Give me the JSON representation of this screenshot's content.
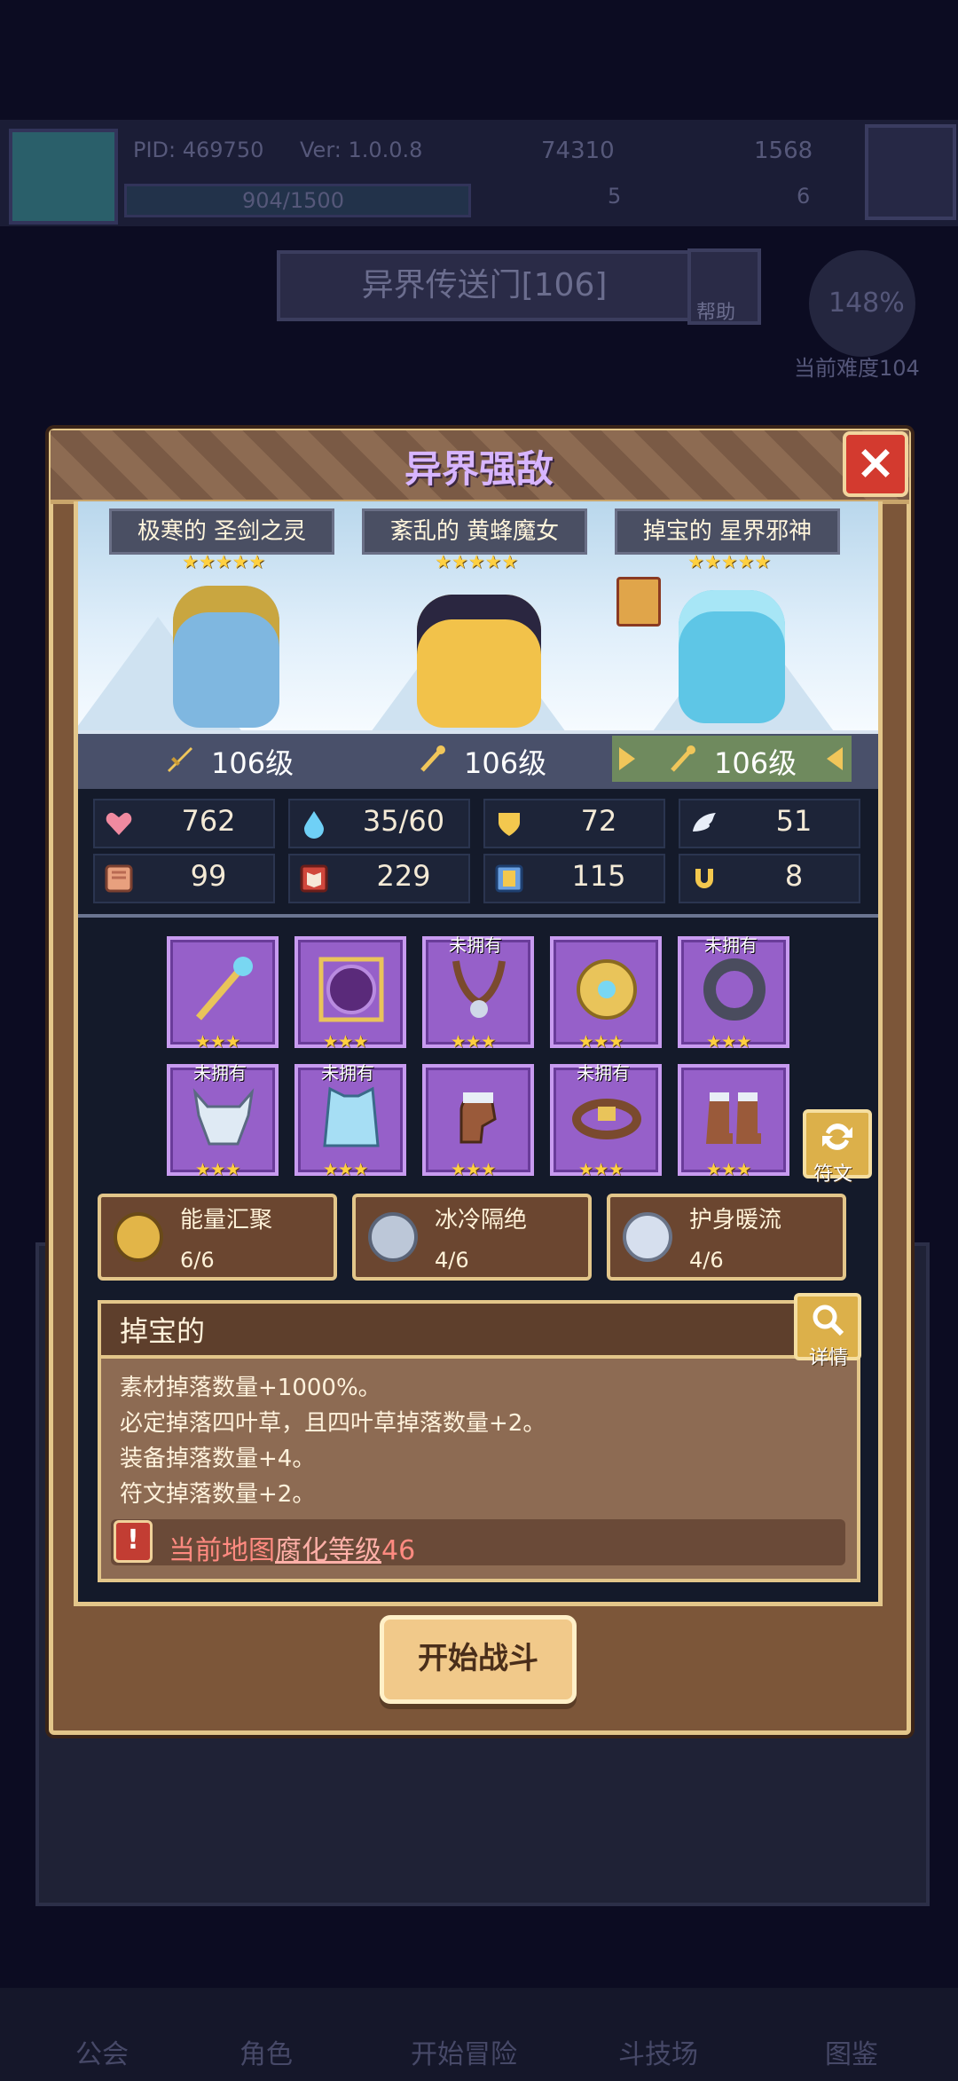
{
  "background": {
    "pid": "PID: 469750",
    "version": "Ver: 1.0.0.8",
    "currency_1": "74310",
    "currency_2": "1568",
    "xp": "904/1500",
    "currency_3": "5",
    "currency_4": "6",
    "portal_title": "异界传送门[106]",
    "help_label": "帮助",
    "difficulty_percent": "148%",
    "difficulty_label": "当前难度104",
    "nav": [
      "公会",
      "角色",
      "开始冒险",
      "斗技场",
      "图鉴"
    ]
  },
  "modal": {
    "title": "异界强敌",
    "enemies": [
      {
        "name": "极寒的 圣剑之灵",
        "stars": "★★★★★",
        "level": "106级",
        "color": "#7fb7e0"
      },
      {
        "name": "紊乱的 黄蜂魔女",
        "stars": "★★★★★",
        "level": "106级",
        "color": "#f2c24a"
      },
      {
        "name": "掉宝的 星界邪神",
        "stars": "★★★★★",
        "level": "106级",
        "color": "#5ec6e6"
      }
    ],
    "stats": [
      {
        "icon": "heart-icon",
        "value": "762"
      },
      {
        "icon": "mana-drop-icon",
        "value": "35/60"
      },
      {
        "icon": "shield-icon",
        "value": "72"
      },
      {
        "icon": "wing-icon",
        "value": "51"
      },
      {
        "icon": "fist-icon",
        "value": "99"
      },
      {
        "icon": "book-icon",
        "value": "229"
      },
      {
        "icon": "scroll-icon",
        "value": "115"
      },
      {
        "icon": "horseshoe-icon",
        "value": "8"
      }
    ],
    "equipment": [
      {
        "name": "staff-icon",
        "stars": "★★★",
        "tag": ""
      },
      {
        "name": "orb-icon",
        "stars": "★★★",
        "tag": ""
      },
      {
        "name": "amulet-icon",
        "stars": "★★★",
        "tag": "未拥有"
      },
      {
        "name": "gold-emblem-icon",
        "stars": "★★★",
        "tag": ""
      },
      {
        "name": "ring-icon",
        "stars": "★★★",
        "tag": "未拥有"
      },
      {
        "name": "beast-helmet-icon",
        "stars": "★★★",
        "tag": "未拥有"
      },
      {
        "name": "ice-armor-icon",
        "stars": "★★★",
        "tag": "未拥有"
      },
      {
        "name": "glove-icon",
        "stars": "★★★",
        "tag": ""
      },
      {
        "name": "belt-icon",
        "stars": "★★★",
        "tag": "未拥有"
      },
      {
        "name": "boots-icon",
        "stars": "★★★",
        "tag": ""
      }
    ],
    "rune_label": "符文",
    "sets": [
      {
        "name": "能量汇聚",
        "count": "6/6",
        "color": "#e2b548"
      },
      {
        "name": "冰冷隔绝",
        "count": "4/6",
        "color": "#bcc7d8"
      },
      {
        "name": "护身暖流",
        "count": "4/6",
        "color": "#d6dfee"
      }
    ],
    "affix": {
      "title": "掉宝的",
      "detail_label": "详情",
      "lines": [
        "素材掉落数量+1000%。",
        "必定掉落四叶草，且四叶草掉落数量+2。",
        "装备掉落数量+4。",
        "符文掉落数量+2。"
      ],
      "warning_prefix": "当前地图",
      "warning_highlight": "腐化等级",
      "warning_suffix": "46"
    },
    "start_label": "开始战斗"
  }
}
